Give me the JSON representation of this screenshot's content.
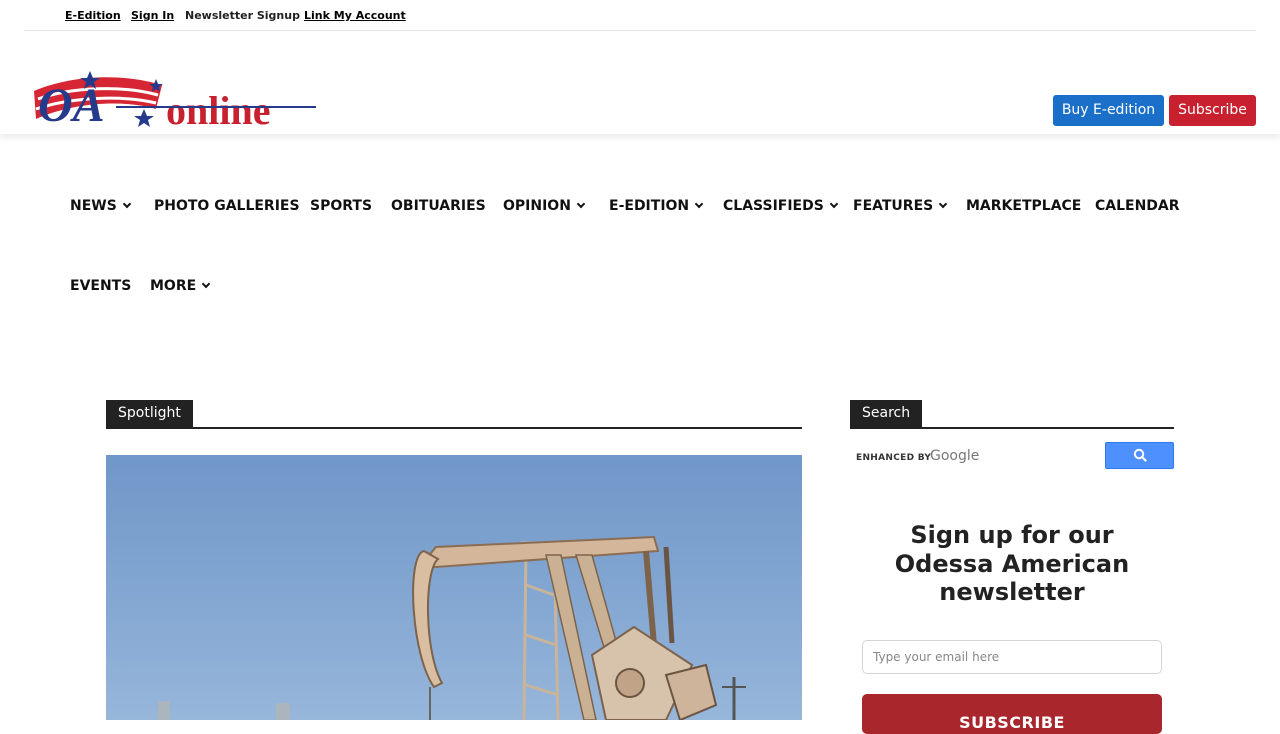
{
  "topbar": {
    "links": [
      "E-Edition",
      "Sign In",
      "Newsletter Signup",
      "Link My Account"
    ]
  },
  "header": {
    "logo_text": "OA online",
    "buy_button": "Buy E-edition",
    "subscribe_button": "Subscribe"
  },
  "nav": {
    "items": [
      {
        "label": "NEWS",
        "dropdown": true
      },
      {
        "label": "PHOTO GALLERIES",
        "dropdown": false
      },
      {
        "label": "SPORTS",
        "dropdown": false
      },
      {
        "label": "OBITUARIES",
        "dropdown": false
      },
      {
        "label": "OPINION",
        "dropdown": true
      },
      {
        "label": "E-EDITION",
        "dropdown": true
      },
      {
        "label": "CLASSIFIEDS",
        "dropdown": true
      },
      {
        "label": "FEATURES",
        "dropdown": true
      },
      {
        "label": "MARKETPLACE",
        "dropdown": false
      },
      {
        "label": "CALENDAR",
        "dropdown": false
      },
      {
        "label": "EVENTS",
        "dropdown": false
      },
      {
        "label": "MORE",
        "dropdown": true
      }
    ]
  },
  "spotlight": {
    "title": "Spotlight",
    "image_alt": "Oil pumpjack under blue sky"
  },
  "search": {
    "title": "Search",
    "enhanced_by": "ENHANCED BY",
    "google": "Google"
  },
  "newsletter": {
    "title": "Sign up for our Odessa American newsletter",
    "email_placeholder": "Type your email here",
    "submit_label": "SUBSCRIBE"
  },
  "colors": {
    "buy_button": "#1a6fc9",
    "subscribe_button": "#c9202f",
    "newsletter_button": "#a8262c",
    "search_button": "#4d90fe"
  }
}
